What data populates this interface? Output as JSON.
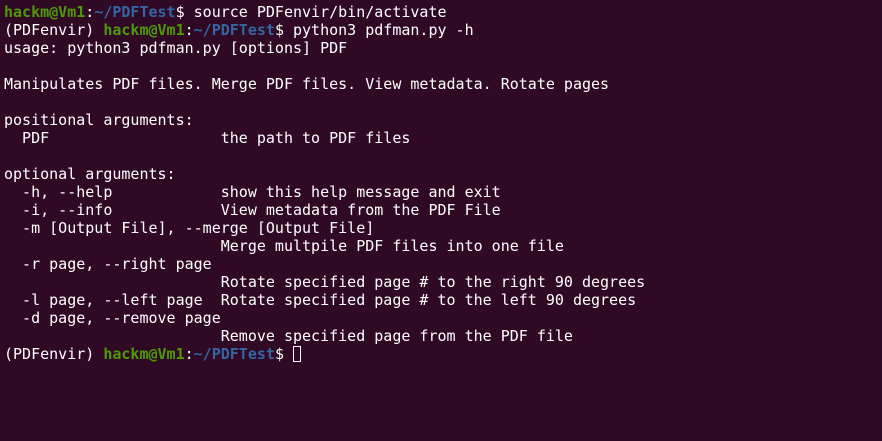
{
  "prompt": {
    "venv": "(PDFenvir) ",
    "user_host": "hackm@Vm1",
    "colon": ":",
    "path": "~/PDFTest",
    "symbol": "$ "
  },
  "commands": [
    "source PDFenvir/bin/activate",
    "python3 pdfman.py -h"
  ],
  "output_lines": [
    "usage: python3 pdfman.py [options] PDF",
    "",
    "Manipulates PDF files. Merge PDF files. View metadata. Rotate pages",
    "",
    "positional arguments:",
    "  PDF                   the path to PDF files",
    "",
    "optional arguments:",
    "  -h, --help            show this help message and exit",
    "  -i, --info            View metadata from the PDF File",
    "  -m [Output File], --merge [Output File]",
    "                        Merge multpile PDF files into one file",
    "  -r page, --right page",
    "                        Rotate specified page # to the right 90 degrees",
    "  -l page, --left page  Rotate specified page # to the left 90 degrees",
    "  -d page, --remove page",
    "                        Remove specified page from the PDF file"
  ],
  "colors": {
    "background": "#300a24",
    "user_host": "#4e9a06",
    "path": "#3465a4",
    "text": "#ffffff"
  }
}
